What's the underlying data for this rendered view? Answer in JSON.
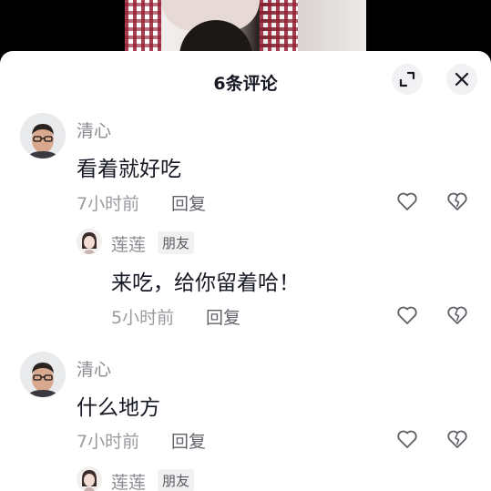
{
  "header": {
    "title": "6条评论",
    "expand_icon": "expand-icon",
    "close_icon": "close-icon"
  },
  "comments": [
    {
      "author": "清心",
      "text": "看着就好吃",
      "time": "7小时前",
      "reply_label": "回复",
      "reply": {
        "author": "莲莲",
        "badge": "朋友",
        "text": "来吃，给你留着哈！",
        "time": "5小时前",
        "reply_label": "回复"
      }
    },
    {
      "author": "清心",
      "text": "什么地方",
      "time": "7小时前",
      "reply_label": "回复",
      "reply": {
        "author": "莲莲",
        "badge": "朋友"
      }
    }
  ],
  "icons": {
    "like": "heart-outline-icon",
    "dislike": "broken-heart-icon"
  }
}
